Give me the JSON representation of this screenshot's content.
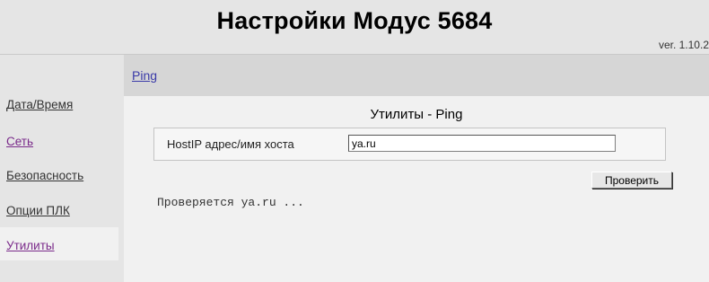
{
  "header": {
    "title": "Настройки Модус 5684",
    "version": "ver. 1.10.2"
  },
  "sidebar": {
    "items": [
      {
        "label": "Дата/Время"
      },
      {
        "label": "Сеть"
      },
      {
        "label": "Безопасность"
      },
      {
        "label": "Опции ПЛК"
      },
      {
        "label": "Утилиты"
      }
    ]
  },
  "subnav": {
    "link": "Ping"
  },
  "main": {
    "title": "Утилиты - Ping",
    "host_label": "HostIP адрес/имя хоста",
    "host_value": "ya.ru",
    "check_label": "Проверить",
    "status_text": "Проверяется ya.ru ..."
  },
  "colors": {
    "background": "#e5e5e5",
    "content_bg": "#f1f1f1",
    "subnav_bg": "#d6d6d6",
    "link": "#333333",
    "visited_link": "#7a2a8a"
  }
}
